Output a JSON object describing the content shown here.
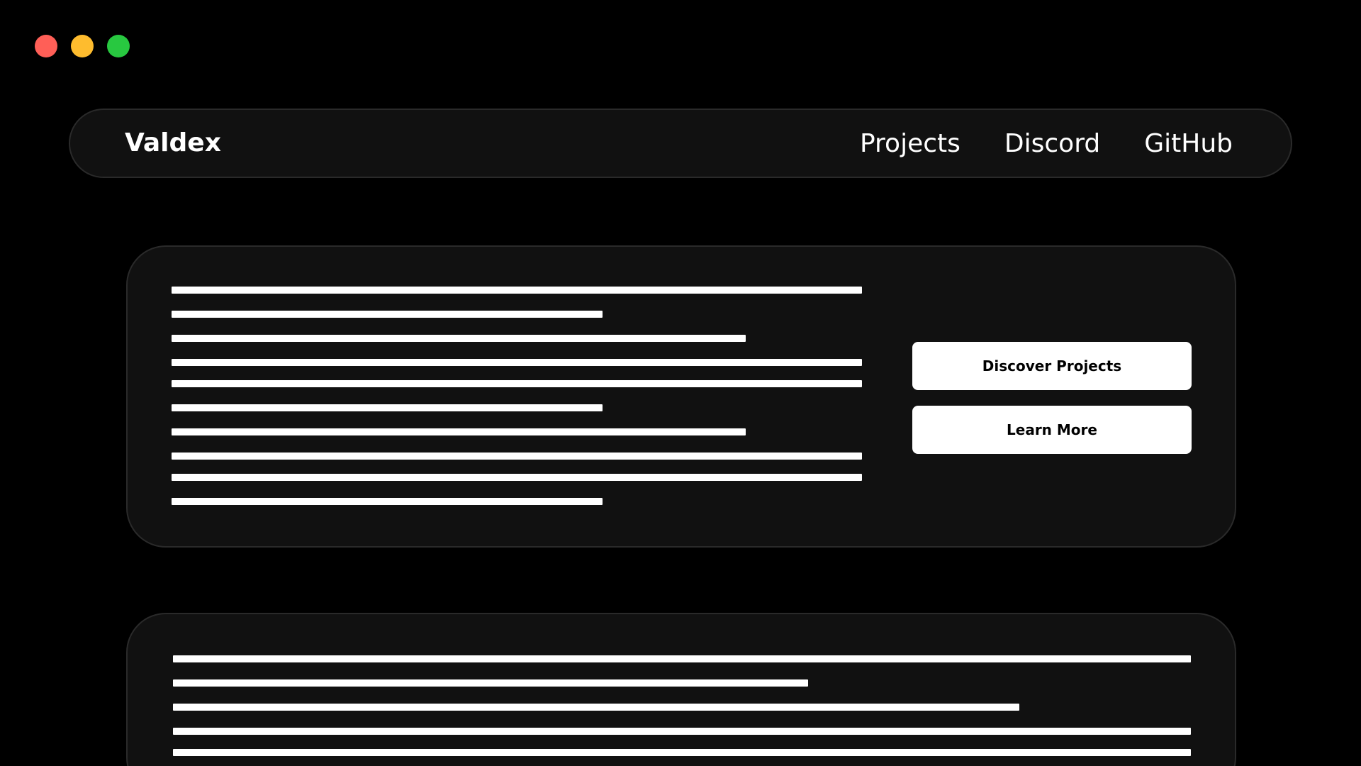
{
  "window_controls": {
    "close_color": "#ff5f57",
    "minimize_color": "#febc2e",
    "maximize_color": "#28c840"
  },
  "nav": {
    "brand": "Valdex",
    "links": [
      "Projects",
      "Discord",
      "GitHub"
    ]
  },
  "hero": {
    "primary_button": "Discover Projects",
    "secondary_button": "Learn More"
  }
}
